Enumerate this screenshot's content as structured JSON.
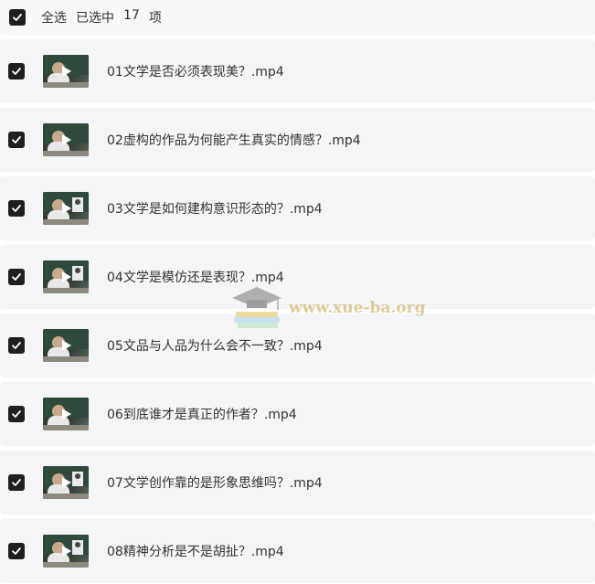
{
  "header": {
    "select_all_label": "全选",
    "selected_label": "已选中",
    "selected_count": "17",
    "count_unit": "项"
  },
  "files": [
    {
      "title": "01文学是否必须表现美？.mp4",
      "checked": true
    },
    {
      "title": "02虚构的作品为何能产生真实的情感？.mp4",
      "checked": true
    },
    {
      "title": "03文学是如何建构意识形态的？.mp4",
      "checked": true
    },
    {
      "title": "04文学是模仿还是表现？.mp4",
      "checked": true
    },
    {
      "title": "05文品与人品为什么会不一致？.mp4",
      "checked": true
    },
    {
      "title": "06到底谁才是真正的作者？.mp4",
      "checked": true
    },
    {
      "title": "07文学创作靠的是形象思维吗？.mp4",
      "checked": true
    },
    {
      "title": "08精神分析是不是胡扯？.mp4",
      "checked": true
    }
  ],
  "watermark": {
    "text": "www.xue-ba.org",
    "icon": "graduation-cap-books-logo"
  },
  "colors": {
    "checkbox": "#1f1f1f",
    "row_background": "#f4f5f7",
    "watermark": "#c9a646"
  }
}
